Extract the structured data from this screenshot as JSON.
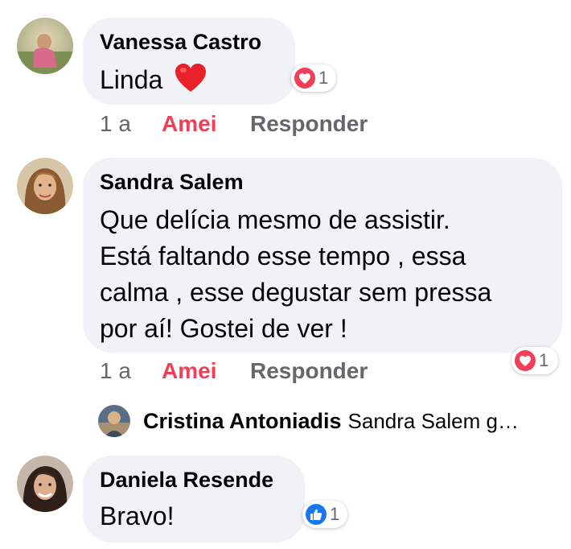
{
  "comments": [
    {
      "author": "Vanessa Castro",
      "text_lines": [
        "Linda"
      ],
      "emoji": "red-heart",
      "reaction": {
        "type": "love",
        "icon": "love-reaction-icon",
        "count": "1",
        "color": "#f33e58"
      },
      "actions": {
        "time": "1 a",
        "reaction_label": "Amei",
        "reply_label": "Responder"
      }
    },
    {
      "author": "Sandra Salem",
      "text_lines": [
        "Que delícia mesmo de assistir.",
        "Está faltando esse tempo , essa",
        "calma , esse degustar sem pressa",
        "por aí! Gostei de ver !"
      ],
      "reaction": {
        "type": "love",
        "icon": "love-reaction-icon",
        "count": "1",
        "color": "#f33e58"
      },
      "actions": {
        "time": "1 a",
        "reaction_label": "Amei",
        "reply_label": "Responder"
      },
      "reply_preview": {
        "author": "Cristina Antoniadis",
        "text": "Sandra Salem g…"
      }
    },
    {
      "author": "Daniela Resende",
      "text_lines": [
        "Bravo!"
      ],
      "reaction": {
        "type": "like",
        "icon": "like-reaction-icon",
        "count": "1",
        "color": "#1877f2"
      }
    }
  ],
  "colors": {
    "bubble": "#f0f2f5",
    "secondary_text": "#65676b",
    "loved_action": "#f33e58",
    "like_blue": "#1877f2"
  }
}
